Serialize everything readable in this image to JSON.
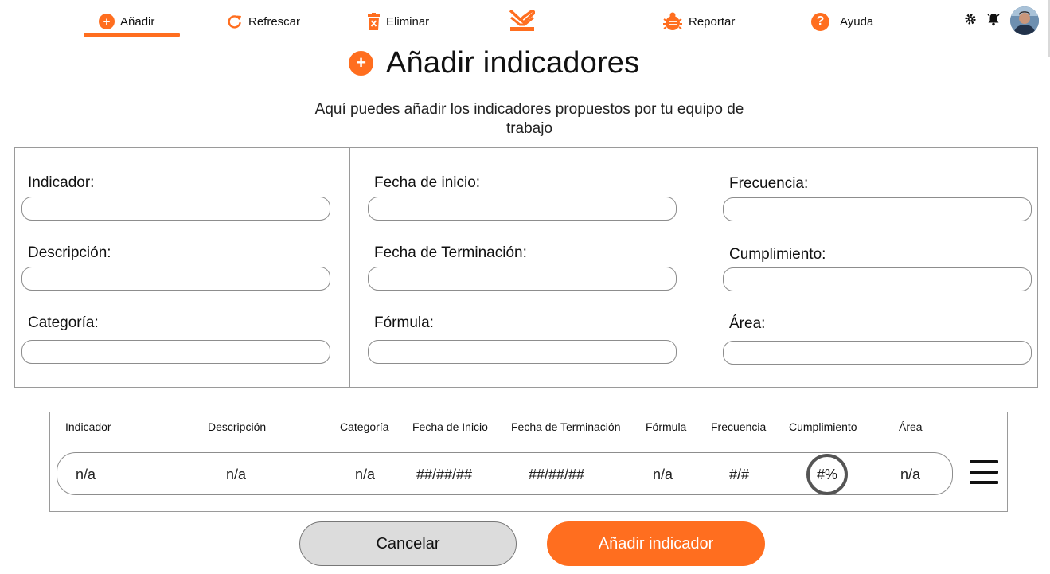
{
  "nav": {
    "add_label": "Añadir",
    "refresh_label": "Refrescar",
    "delete_label": "Eliminar",
    "report_label": "Reportar",
    "help_label": "Ayuda",
    "help_glyph": "?",
    "add_glyph": "+"
  },
  "page": {
    "title": "Añadir indicadores",
    "title_glyph": "+",
    "subtitle": "Aquí puedes añadir los indicadores propuestos por tu equipo de trabajo"
  },
  "form": {
    "indicador": {
      "label": "Indicador:",
      "value": ""
    },
    "descripcion": {
      "label": "Descripción:",
      "value": ""
    },
    "categoria": {
      "label": "Categoría:",
      "value": ""
    },
    "fecha_inicio": {
      "label": "Fecha de inicio:",
      "value": ""
    },
    "fecha_terminacion": {
      "label": "Fecha de Terminación:",
      "value": ""
    },
    "formula": {
      "label": "Fórmula:",
      "value": ""
    },
    "frecuencia": {
      "label": "Frecuencia:",
      "value": ""
    },
    "cumplimiento": {
      "label": "Cumplimiento:",
      "value": ""
    },
    "area": {
      "label": "Área:",
      "value": ""
    }
  },
  "table": {
    "headers": [
      "Indicador",
      "Descripción",
      "Categoría",
      "Fecha de Inicio",
      "Fecha de Terminación",
      "Fórmula",
      "Frecuencia",
      "Cumplimiento",
      "Área"
    ],
    "row": [
      "n/a",
      "n/a",
      "n/a",
      "##/##/##",
      "##/##/##",
      "n/a",
      "#/#",
      "#%",
      "n/a"
    ]
  },
  "buttons": {
    "cancel": "Cancelar",
    "submit": "Añadir indicador"
  },
  "colors": {
    "accent": "#ff6e1f",
    "cancel_bg": "#dcdcdc",
    "border": "#9a9a9a"
  },
  "icons": {
    "nav": [
      "add-icon",
      "refresh-icon",
      "trash-icon",
      "logo-icon",
      "bug-icon",
      "help-icon",
      "gear-icon",
      "bell-icon",
      "avatar"
    ],
    "table": [
      "menu-icon"
    ]
  }
}
